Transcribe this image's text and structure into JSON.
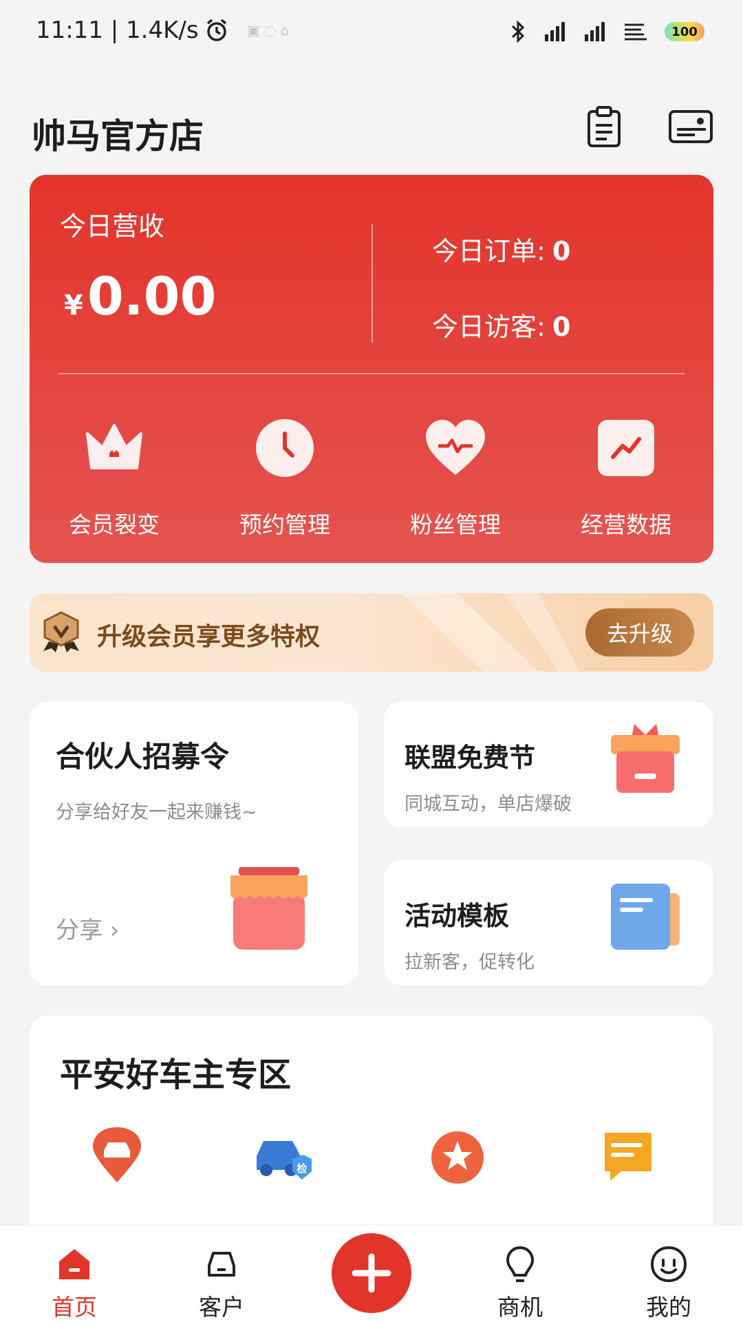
{
  "status_bar": {
    "time_speed": "11:11 | 1.4K/s",
    "battery": "100"
  },
  "header": {
    "title": "帅马官方店"
  },
  "summary": {
    "revenue_label": "今日营收",
    "currency": "¥",
    "revenue_value": "0.00",
    "orders_label": "今日订单:",
    "orders_value": "0",
    "visitors_label": "今日访客:",
    "visitors_value": "0"
  },
  "quick_actions": [
    {
      "label": "会员裂变",
      "icon": "crown-icon"
    },
    {
      "label": "预约管理",
      "icon": "clock-icon"
    },
    {
      "label": "粉丝管理",
      "icon": "heart-pulse-icon"
    },
    {
      "label": "经营数据",
      "icon": "trend-chart-icon"
    }
  ],
  "upgrade": {
    "text": "升级会员享更多特权",
    "button": "去升级"
  },
  "partner_card": {
    "title": "合伙人招募令",
    "subtitle": "分享给好友一起来赚钱~",
    "link": "分享 ›"
  },
  "alliance_card": {
    "title": "联盟免费节",
    "subtitle": "同城互动，单店爆破"
  },
  "template_card": {
    "title": "活动模板",
    "subtitle": "拉新客，促转化"
  },
  "ping_an": {
    "title": "平安好车主专区"
  },
  "tabbar": [
    {
      "label": "首页",
      "icon": "home-icon",
      "active": true
    },
    {
      "label": "客户",
      "icon": "customer-icon",
      "active": false
    },
    {
      "label": "商机",
      "icon": "bulb-icon",
      "active": false
    },
    {
      "label": "我的",
      "icon": "smile-face-icon",
      "active": false
    }
  ],
  "colors": {
    "brand_red": "#e3342b",
    "gold": "#a96a32"
  }
}
